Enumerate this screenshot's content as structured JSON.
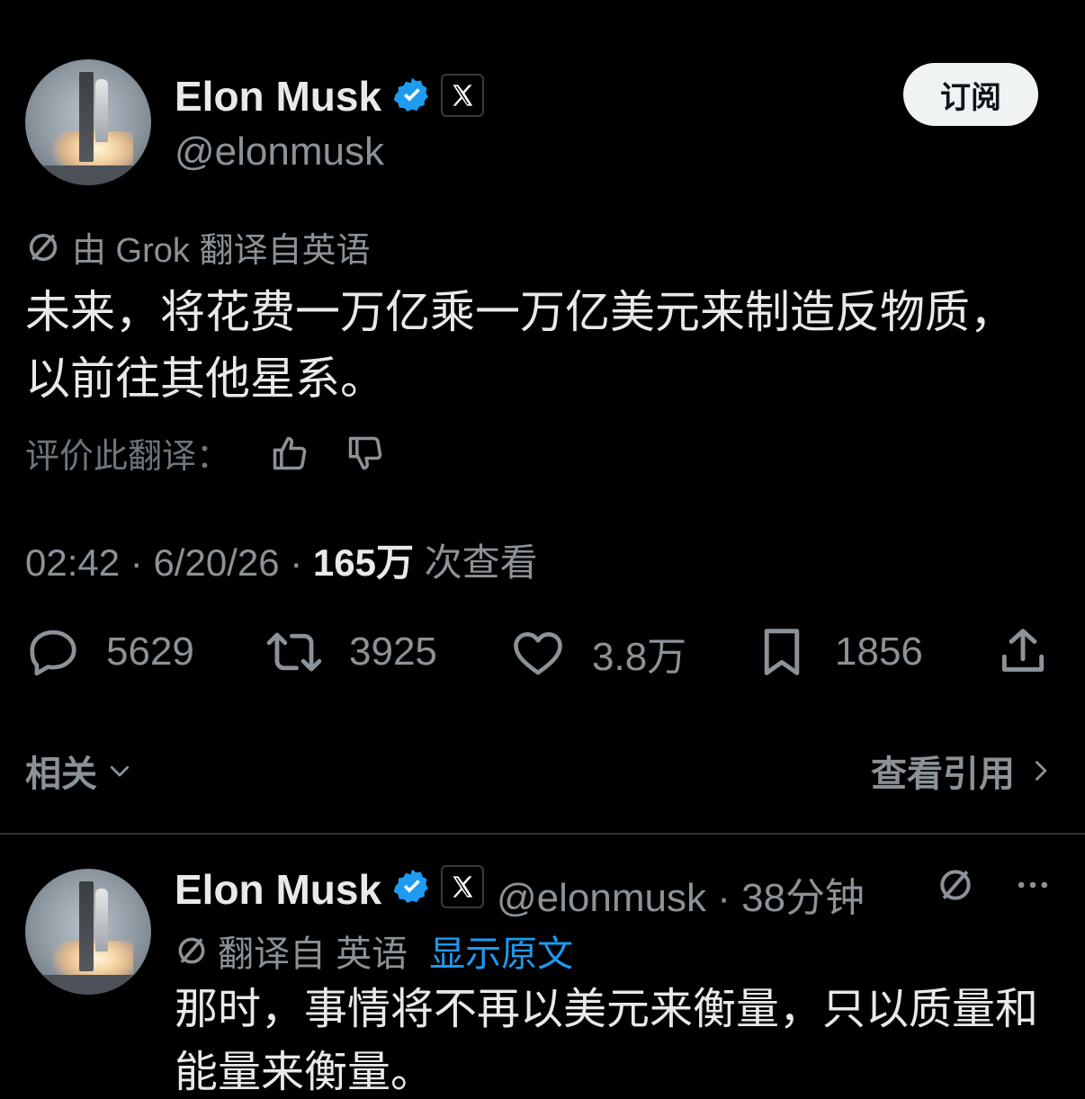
{
  "tweet": {
    "author_name": "Elon Musk",
    "handle": "@elonmusk",
    "subscribe_label": "订阅",
    "translation_note": "由 Grok 翻译自英语",
    "text": "未来，将花费一万亿乘一万亿美元来制造反物质，以前往其他星系。",
    "rate_label": "评价此翻译：",
    "time": "02:42",
    "date": "6/20/26",
    "views_count": "165万",
    "views_label": "次查看",
    "replies": "5629",
    "retweets": "3925",
    "likes": "3.8万",
    "bookmarks": "1856"
  },
  "footer": {
    "related_label": "相关",
    "quotes_label": "查看引用"
  },
  "reply": {
    "author_name": "Elon Musk",
    "handle": "@elonmusk",
    "time_ago": "38分钟",
    "translated_from": "翻译自 英语",
    "show_original": "显示原文",
    "text": "那时，事情将不再以美元来衡量，只以质量和能量来衡量。"
  },
  "icons": {
    "verified": "verified-badge-icon",
    "x_badge": "x-logo-icon",
    "translate": "translate-icon",
    "thumbs_up": "thumbs-up-icon",
    "thumbs_down": "thumbs-down-icon",
    "reply": "reply-icon",
    "retweet": "retweet-icon",
    "like": "heart-icon",
    "bookmark": "bookmark-icon",
    "share": "share-icon",
    "more": "more-icon"
  },
  "colors": {
    "background": "#000000",
    "text": "#e7e9ea",
    "muted": "#8b9298",
    "link": "#1d9bf0",
    "verified": "#1d9bf0"
  }
}
